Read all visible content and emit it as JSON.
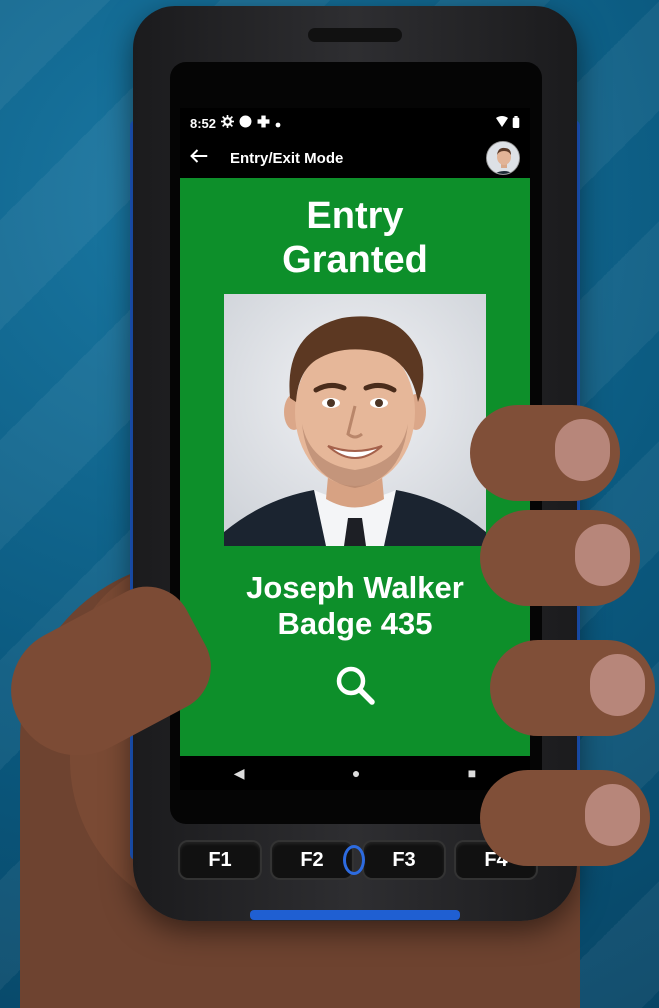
{
  "status_bar": {
    "time": "8:52",
    "icons": [
      "gear-icon",
      "circle-icon",
      "plus-icon",
      "dot-icon"
    ],
    "right_icons": [
      "wifi-icon",
      "battery-icon"
    ]
  },
  "app_bar": {
    "title": "Entry/Exit Mode",
    "back_icon": "back-arrow-icon"
  },
  "result": {
    "line1": "Entry",
    "line2": "Granted",
    "background_color": "#0d8f2a"
  },
  "person": {
    "name": "Joseph Walker",
    "badge": "Badge 435"
  },
  "nav_bar": {
    "back": "◀",
    "home": "●",
    "recents": "■"
  },
  "hardware_keys": [
    "F1",
    "F2",
    "F3",
    "F4"
  ]
}
